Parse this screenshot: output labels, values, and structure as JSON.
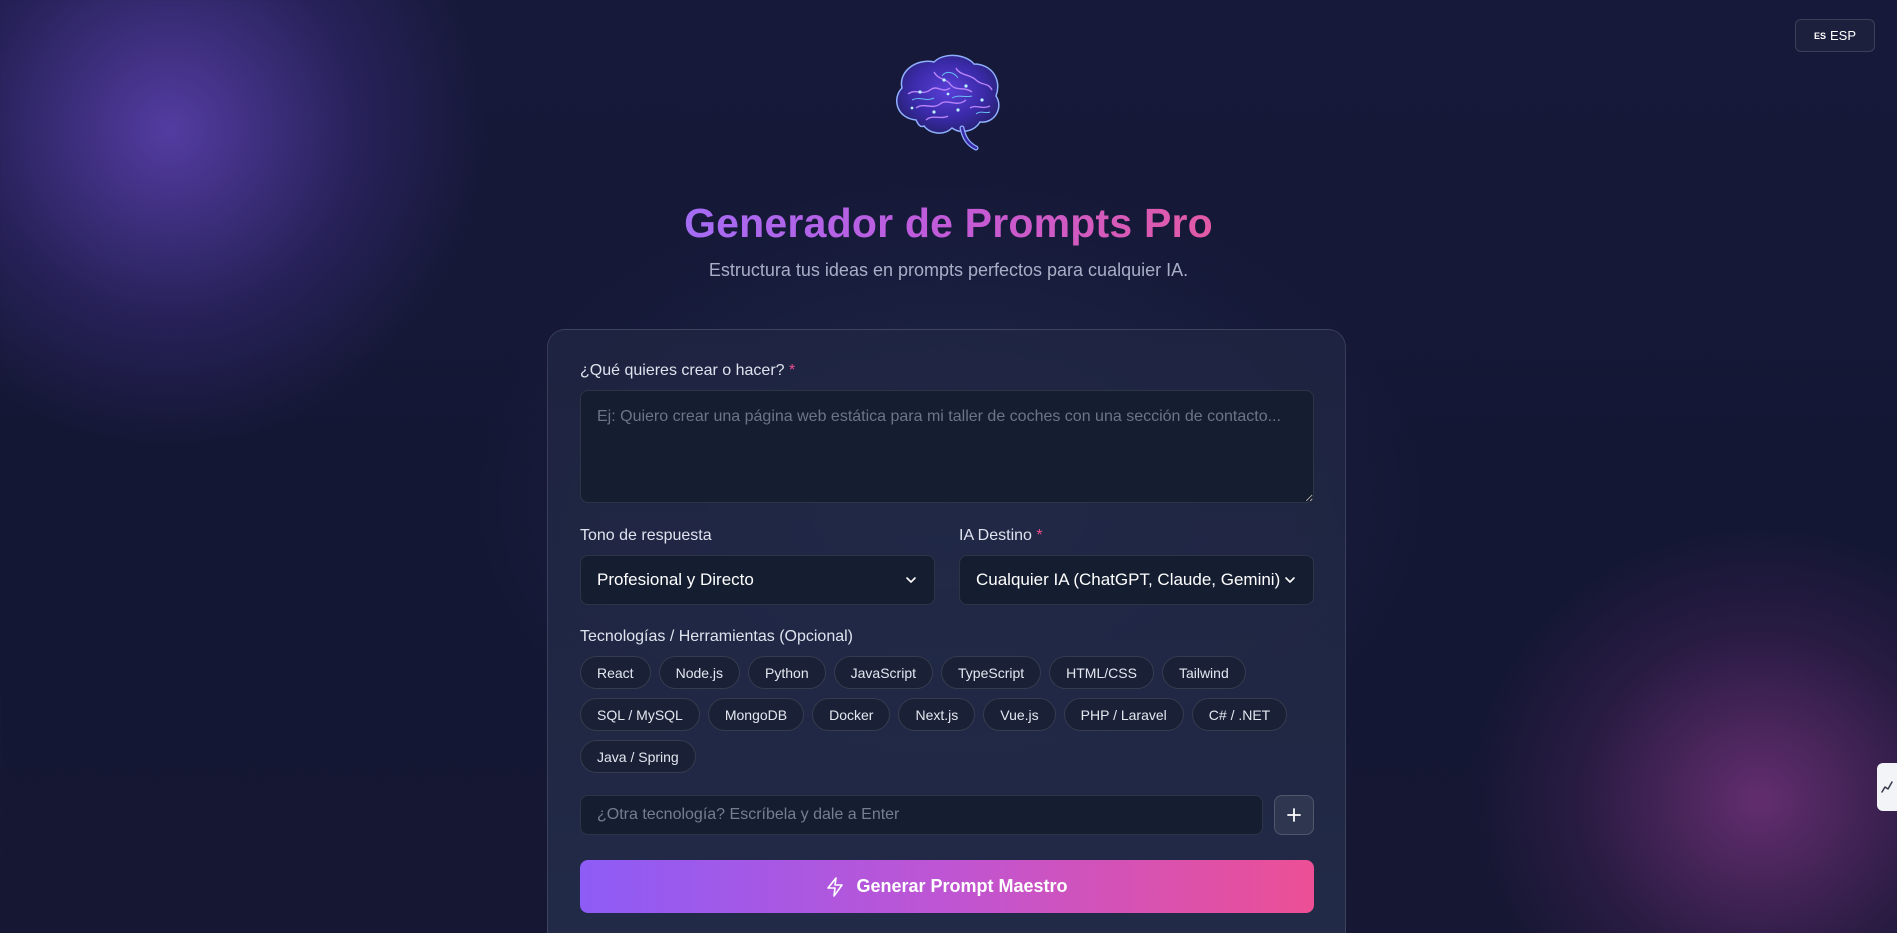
{
  "language": {
    "flag": "ES",
    "label": "ESP"
  },
  "header": {
    "title": "Generador de Prompts Pro",
    "subtitle": "Estructura tus ideas en prompts perfectos para cualquier IA."
  },
  "form": {
    "idea": {
      "label": "¿Qué quieres crear o hacer?",
      "required_mark": "*",
      "value": "",
      "placeholder": "Ej: Quiero crear una página web estática para mi taller de coches con una sección de contacto..."
    },
    "tone": {
      "label": "Tono de respuesta",
      "selected": "Profesional y Directo"
    },
    "target_ai": {
      "label": "IA Destino",
      "required_mark": "*",
      "selected": "Cualquier IA (ChatGPT, Claude, Gemini)"
    },
    "technologies": {
      "label": "Tecnologías / Herramientas (Opcional)",
      "rows": [
        [
          "React",
          "Node.js",
          "Python",
          "JavaScript",
          "TypeScript",
          "HTML/CSS",
          "Tailwind"
        ],
        [
          "SQL / MySQL",
          "MongoDB",
          "Docker",
          "Next.js",
          "Vue.js",
          "PHP / Laravel",
          "C# / .NET"
        ],
        [
          "Java / Spring"
        ]
      ],
      "custom_placeholder": "¿Otra tecnología? Escríbela y dale a Enter",
      "custom_value": ""
    },
    "submit_label": "Generar Prompt Maestro"
  },
  "colors": {
    "accent_start": "#8d5cf6",
    "accent_end": "#ec4f95",
    "required": "#ec4e8f"
  },
  "icons": [
    "brain-logo",
    "chevron-down-icon",
    "plus-icon",
    "lightning-icon"
  ]
}
